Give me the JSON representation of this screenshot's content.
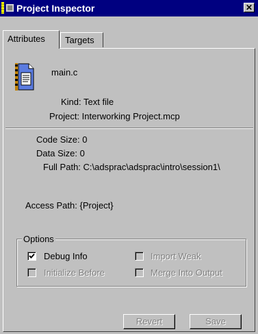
{
  "window": {
    "title": "Project Inspector",
    "close_label": "✕"
  },
  "tabs": [
    {
      "label": "Attributes",
      "selected": true
    },
    {
      "label": "Targets",
      "selected": false
    }
  ],
  "file": {
    "name": "main.c",
    "kind": "Kind: Text file",
    "project": "Project: Interworking Project.mcp",
    "icon": "text-file-icon"
  },
  "details": {
    "code_size": "Code Size: 0",
    "data_size": "Data Size: 0",
    "full_path": "Full Path: C:\\adsprac\\adsprac\\intro\\session1\\",
    "access_path": "Access Path: {Project}"
  },
  "options": {
    "legend": "Options",
    "debug_info": {
      "label": "Debug Info",
      "checked": true,
      "enabled": true
    },
    "import_weak": {
      "label": "Import Weak",
      "checked": false,
      "enabled": false
    },
    "initialize_before": {
      "label": "Initialize Before",
      "checked": false,
      "enabled": false
    },
    "merge_into_output": {
      "label": "Merge Into Output",
      "checked": false,
      "enabled": false
    }
  },
  "buttons": {
    "revert": "Revert",
    "save": "Save"
  }
}
